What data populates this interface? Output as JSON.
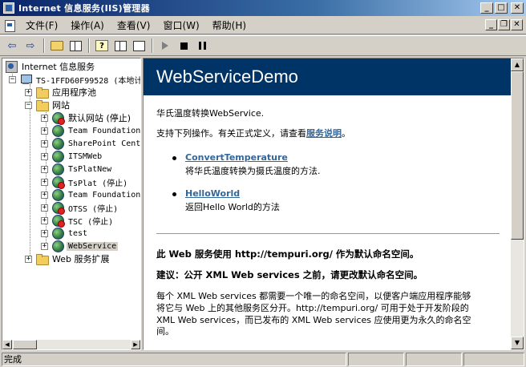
{
  "window": {
    "title": "Internet 信息服务(IIS)管理器",
    "min_glyph": "_",
    "max_glyph": "□",
    "close_glyph": "✕"
  },
  "menu": {
    "items": [
      "文件(F)",
      "操作(A)",
      "查看(V)",
      "窗口(W)",
      "帮助(H)"
    ],
    "mdi_min": "_",
    "mdi_restore": "❐",
    "mdi_close": "✕"
  },
  "toolbar": {
    "back_glyph": "⇦",
    "forward_glyph": "⇨"
  },
  "tree": {
    "root": "Internet 信息服务",
    "server": "TS-1FFD60F99528 (本地计",
    "app_pools": "应用程序池",
    "websites": "网站",
    "sites": [
      {
        "label": "默认网站 (停止)",
        "stopped": true
      },
      {
        "label": "Team Foundation",
        "stopped": false
      },
      {
        "label": "SharePoint Cent",
        "stopped": false
      },
      {
        "label": "ITSMWeb",
        "stopped": false
      },
      {
        "label": "TsPlatNew",
        "stopped": false
      },
      {
        "label": "TsPlat (停止)",
        "stopped": true
      },
      {
        "label": "Team Foundation",
        "stopped": false
      },
      {
        "label": "OTSS (停止)",
        "stopped": true
      },
      {
        "label": "TSC (停止)",
        "stopped": true
      },
      {
        "label": "test",
        "stopped": false
      },
      {
        "label": "WebService",
        "stopped": false,
        "selected": true
      }
    ],
    "extensions": "Web 服务扩展",
    "expand_glyph": "+",
    "collapse_glyph": "−"
  },
  "content": {
    "service_name": "WebServiceDemo",
    "description": "华氏温度转换WebService.",
    "supported_ops_prefix": "支持下列操作。有关正式定义，请查看",
    "service_desc_link": "服务说明",
    "supported_ops_suffix": "。",
    "operations": [
      {
        "name": "ConvertTemperature",
        "desc": "将华氏温度转换为摄氏温度的方法."
      },
      {
        "name": "HelloWorld",
        "desc": "返回Hello World的方法"
      }
    ],
    "namespace_note": "此 Web 服务使用 http://tempuri.org/ 作为默认命名空间。",
    "recommend_note": "建议：公开 XML Web services 之前，请更改默认命名空间。",
    "para_line1": "每个 XML Web services 都需要一个唯一的命名空间，以便客户端应用程序能够",
    "para_line2": "将它与 Web 上的其他服务区分开。http://tempuri.org/ 可用于处于开发阶段的",
    "para_line3": "XML Web services，而已发布的 XML Web services 应使用更为永久的命名空",
    "para_line4": "间。"
  },
  "scroll": {
    "up": "▲",
    "down": "▼",
    "left": "◀",
    "right": "▶"
  },
  "status": {
    "text": "完成"
  }
}
